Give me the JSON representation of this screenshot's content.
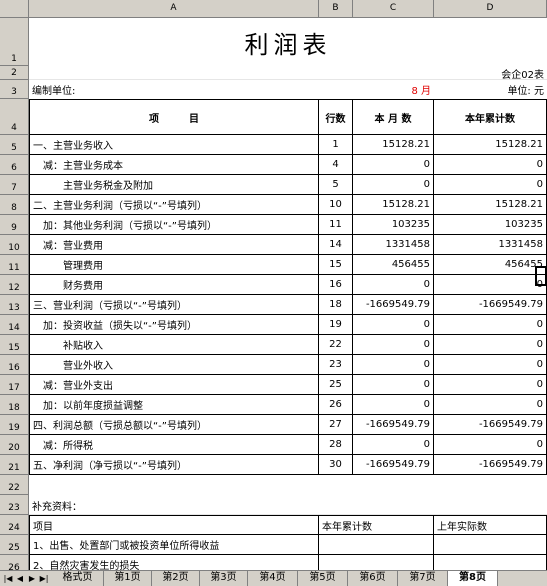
{
  "sheet": {
    "column_headers": [
      "A",
      "B",
      "C",
      "D"
    ],
    "row_numbers": [
      "1",
      "2",
      "3",
      "4",
      "5",
      "6",
      "7",
      "8",
      "9",
      "10",
      "11",
      "12",
      "13",
      "14",
      "15",
      "16",
      "17",
      "18",
      "19",
      "20",
      "21",
      "22",
      "23",
      "24",
      "25",
      "26"
    ]
  },
  "report": {
    "title": "利润表",
    "form_no": "会企02表",
    "company_label": "编制单位:",
    "month": "8 月",
    "unit": "单位: 元",
    "headers": {
      "item": "项　　　目",
      "line": "行数",
      "month": "本 月 数",
      "year": "本年累计数"
    },
    "rows": [
      {
        "item": "一、主营业务收入",
        "line": "1",
        "month": "15128.21",
        "year": "15128.21"
      },
      {
        "item": "　减：主营业务成本",
        "line": "4",
        "month": "0",
        "year": "0"
      },
      {
        "item": "　　　主营业务税金及附加",
        "line": "5",
        "month": "0",
        "year": "0"
      },
      {
        "item": "二、主营业务利润（亏损以“-”号填列）",
        "line": "10",
        "month": "15128.21",
        "year": "15128.21"
      },
      {
        "item": "　加：其他业务利润（亏损以“-”号填列）",
        "line": "11",
        "month": "103235",
        "year": "103235"
      },
      {
        "item": "　减：营业费用",
        "line": "14",
        "month": "1331458",
        "year": "1331458"
      },
      {
        "item": "　　　管理费用",
        "line": "15",
        "month": "456455",
        "year": "456455"
      },
      {
        "item": "　　　财务费用",
        "line": "16",
        "month": "0",
        "year": "0"
      },
      {
        "item": "三、营业利润（亏损以“-”号填列）",
        "line": "18",
        "month": "-1669549.79",
        "year": "-1669549.79"
      },
      {
        "item": "　加：投资收益（损失以“-”号填列）",
        "line": "19",
        "month": "0",
        "year": "0"
      },
      {
        "item": "　　　补贴收入",
        "line": "22",
        "month": "0",
        "year": "0"
      },
      {
        "item": "　　　营业外收入",
        "line": "23",
        "month": "0",
        "year": "0"
      },
      {
        "item": "　减：营业外支出",
        "line": "25",
        "month": "0",
        "year": "0"
      },
      {
        "item": "　加：以前年度损益调整",
        "line": "26",
        "month": "0",
        "year": "0"
      },
      {
        "item": "四、利润总额（亏损总额以“-”号填列）",
        "line": "27",
        "month": "-1669549.79",
        "year": "-1669549.79"
      },
      {
        "item": "　减：所得税",
        "line": "28",
        "month": "0",
        "year": "0"
      },
      {
        "item": "五、净利润（净亏损以“-”号填列）",
        "line": "30",
        "month": "-1669549.79",
        "year": "-1669549.79"
      }
    ],
    "supplement_label": "补充资料：",
    "supplement_headers": {
      "item": "项目",
      "this_year": "本年累计数",
      "last_year": "上年实际数"
    },
    "supplement_rows": [
      {
        "item": "1、出售、处置部门或被投资单位所得收益"
      },
      {
        "item": "2、自然灾害发生的损失"
      }
    ]
  },
  "tabbar": {
    "nav_icons": [
      "first-sheet-icon",
      "prev-sheet-icon",
      "next-sheet-icon",
      "last-sheet-icon"
    ],
    "tabs": [
      "格式页",
      "第1页",
      "第2页",
      "第3页",
      "第4页",
      "第5页",
      "第6页",
      "第7页",
      "第8页"
    ],
    "active_tab": "第8页"
  }
}
